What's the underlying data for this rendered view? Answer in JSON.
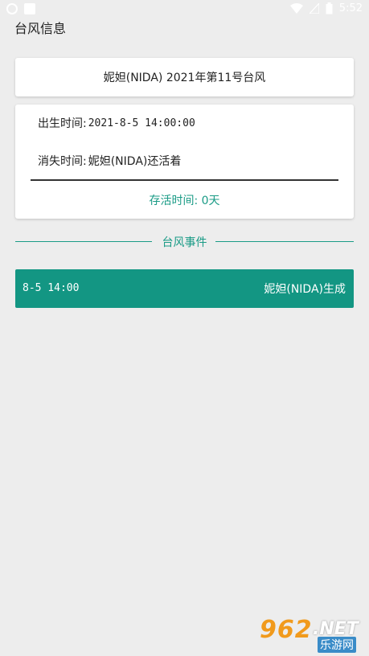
{
  "status_bar": {
    "time": "5:52",
    "icons": [
      "notification-icon",
      "square-icon",
      "wifi-icon",
      "battery-icon"
    ]
  },
  "app": {
    "title": "台风信息"
  },
  "typhoon": {
    "name_title": "妮妲(NIDA) 2021年第11号台风",
    "birth_label": "出生时间:",
    "birth_value": "2021-8-5 14:00:00",
    "death_label": "消失时间:",
    "death_value": "妮妲(NIDA)还活着",
    "survive_text": "存活时间: 0天"
  },
  "events_section": {
    "label": "台风事件",
    "items": [
      {
        "time": "8-5 14:00",
        "desc": "妮妲(NIDA)生成"
      }
    ]
  },
  "watermark": {
    "num": "962",
    "net": ".NET",
    "name": "乐游网"
  },
  "colors": {
    "accent": "#1a9b86",
    "event_bg": "#139683",
    "background": "#ededed"
  }
}
